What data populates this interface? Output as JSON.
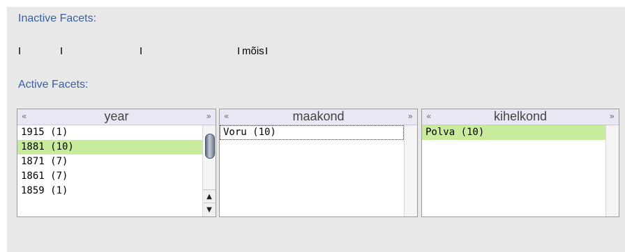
{
  "inactive": {
    "heading": "Inactive Facets:",
    "separator": "I",
    "link": "mõis"
  },
  "active": {
    "heading": "Active Facets:"
  },
  "facets": [
    {
      "title": "year",
      "chevron_left": "«",
      "chevron_right": "»",
      "items": [
        "1915 (1)",
        "1881 (10)",
        "1871 (7)",
        "1861 (7)",
        "1859 (1)"
      ],
      "selected_index": 1
    },
    {
      "title": "maakond",
      "chevron_left": "«",
      "chevron_right": "»",
      "items": [
        "Voru (10)"
      ],
      "selected_index": 0
    },
    {
      "title": "kihelkond",
      "chevron_left": "«",
      "chevron_right": "»",
      "items": [
        "Polva (10)"
      ],
      "selected_index": 0
    }
  ],
  "scroll_icons": {
    "up": "▲",
    "down": "▼"
  }
}
